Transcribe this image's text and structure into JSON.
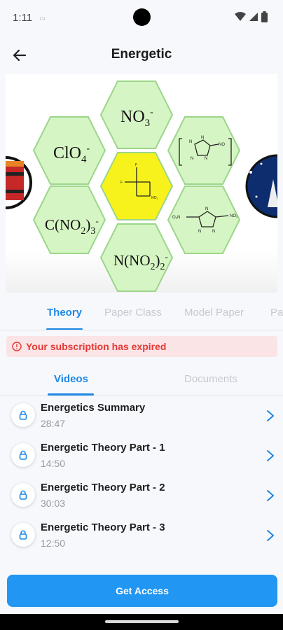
{
  "status_bar": {
    "time": "1:11",
    "app_icon": "sim-icon"
  },
  "header": {
    "title": "Energetic",
    "back_icon": "arrow-left-icon"
  },
  "banner": {
    "hexagons": [
      "NO3-",
      "ClO4-",
      "C(NO2)3-",
      "N(NO2)2-"
    ]
  },
  "tabs": [
    {
      "label": "Theory",
      "active": true
    },
    {
      "label": "Paper Class",
      "active": false
    },
    {
      "label": "Model Paper",
      "active": false
    },
    {
      "label": "Pa",
      "active": false
    }
  ],
  "alert": {
    "text": "Your subscription has expired",
    "icon": "alert-circle-icon",
    "color": "#e53935"
  },
  "sub_tabs": [
    {
      "label": "Videos",
      "active": true
    },
    {
      "label": "Documents",
      "active": false
    }
  ],
  "videos": [
    {
      "title": "Energetics Summary",
      "duration": "28:47"
    },
    {
      "title": "Energetic Theory Part - 1",
      "duration": "14:50"
    },
    {
      "title": "Energetic Theory Part - 2",
      "duration": "30:03"
    },
    {
      "title": "Energetic Theory Part - 3",
      "duration": "12:50"
    }
  ],
  "cta": {
    "label": "Get Access"
  },
  "colors": {
    "accent": "#1e88e5",
    "button": "#2196f3",
    "hex_green": "#d6f5c4",
    "hex_yellow": "#f7f21c"
  }
}
